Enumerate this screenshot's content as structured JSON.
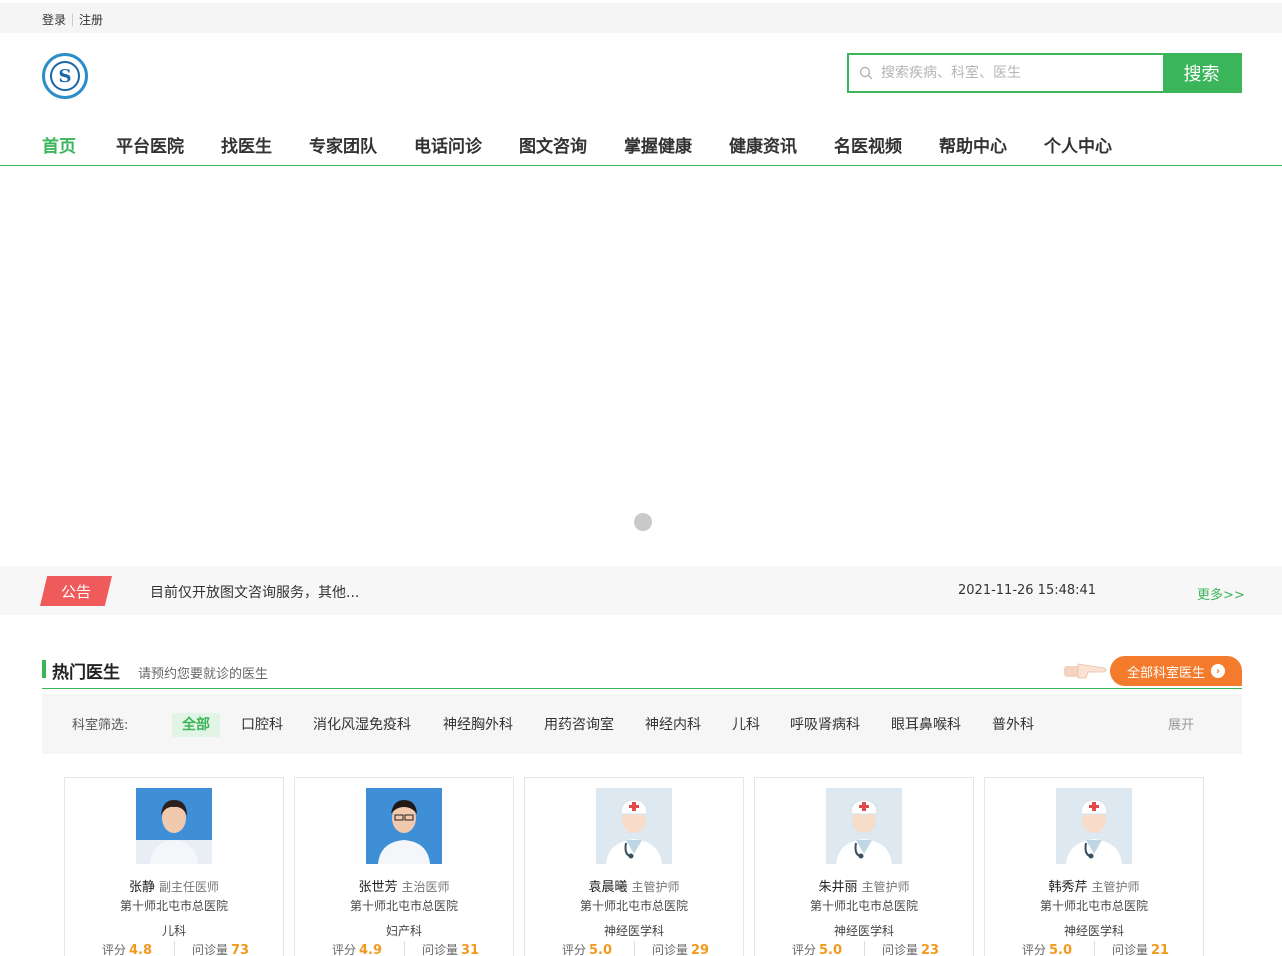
{
  "topbar": {
    "login": "登录",
    "register": "注册"
  },
  "logo": {
    "glyph": "S"
  },
  "search": {
    "placeholder": "搜索疾病、科室、医生",
    "button": "搜索"
  },
  "nav": [
    {
      "label": "首页",
      "active": true
    },
    {
      "label": "平台医院"
    },
    {
      "label": "找医生"
    },
    {
      "label": "专家团队"
    },
    {
      "label": "电话问诊"
    },
    {
      "label": "图文咨询"
    },
    {
      "label": "掌握健康"
    },
    {
      "label": "健康资讯"
    },
    {
      "label": "名医视频"
    },
    {
      "label": "帮助中心"
    },
    {
      "label": "个人中心"
    }
  ],
  "notice": {
    "tag": "公告",
    "text": "目前仅开放图文咨询服务，其他...",
    "time": "2021-11-26 15:48:41",
    "more": "更多>>"
  },
  "section": {
    "title": "热门医生",
    "subtitle": "请预约您要就诊的医生",
    "all_button": "全部科室医生"
  },
  "filter": {
    "label": "科室筛选:",
    "options": [
      "全部",
      "口腔科",
      "消化风湿免疫科",
      "神经胸外科",
      "用药咨询室",
      "神经内科",
      "儿科",
      "呼吸肾病科",
      "眼耳鼻喉科",
      "普外科"
    ],
    "expand": "展开"
  },
  "doctors": [
    {
      "name": "张静",
      "title": "副主任医师",
      "hospital": "第十师北屯市总医院",
      "dept": "儿科",
      "score_label": "评分",
      "score": "4.8",
      "count_label": "问诊量",
      "count": "73",
      "avatar": "photo-female"
    },
    {
      "name": "张世芳",
      "title": "主治医师",
      "hospital": "第十师北屯市总医院",
      "dept": "妇产科",
      "score_label": "评分",
      "score": "4.9",
      "count_label": "问诊量",
      "count": "31",
      "avatar": "photo-female-glasses"
    },
    {
      "name": "袁晨曦",
      "title": "主管护师",
      "hospital": "第十师北屯市总医院",
      "dept": "神经医学科",
      "score_label": "评分",
      "score": "5.0",
      "count_label": "问诊量",
      "count": "29",
      "avatar": "default-doctor-icon"
    },
    {
      "name": "朱井丽",
      "title": "主管护师",
      "hospital": "第十师北屯市总医院",
      "dept": "神经医学科",
      "score_label": "评分",
      "score": "5.0",
      "count_label": "问诊量",
      "count": "23",
      "avatar": "default-doctor-icon"
    },
    {
      "name": "韩秀芹",
      "title": "主管护师",
      "hospital": "第十师北屯市总医院",
      "dept": "神经医学科",
      "score_label": "评分",
      "score": "5.0",
      "count_label": "问诊量",
      "count": "21",
      "avatar": "default-doctor-icon"
    }
  ],
  "colors": {
    "accent": "#3bb55a",
    "notice_tag": "#ef5a5a",
    "all_button": "#f47a2c",
    "stat_value": "#f29a1f"
  }
}
